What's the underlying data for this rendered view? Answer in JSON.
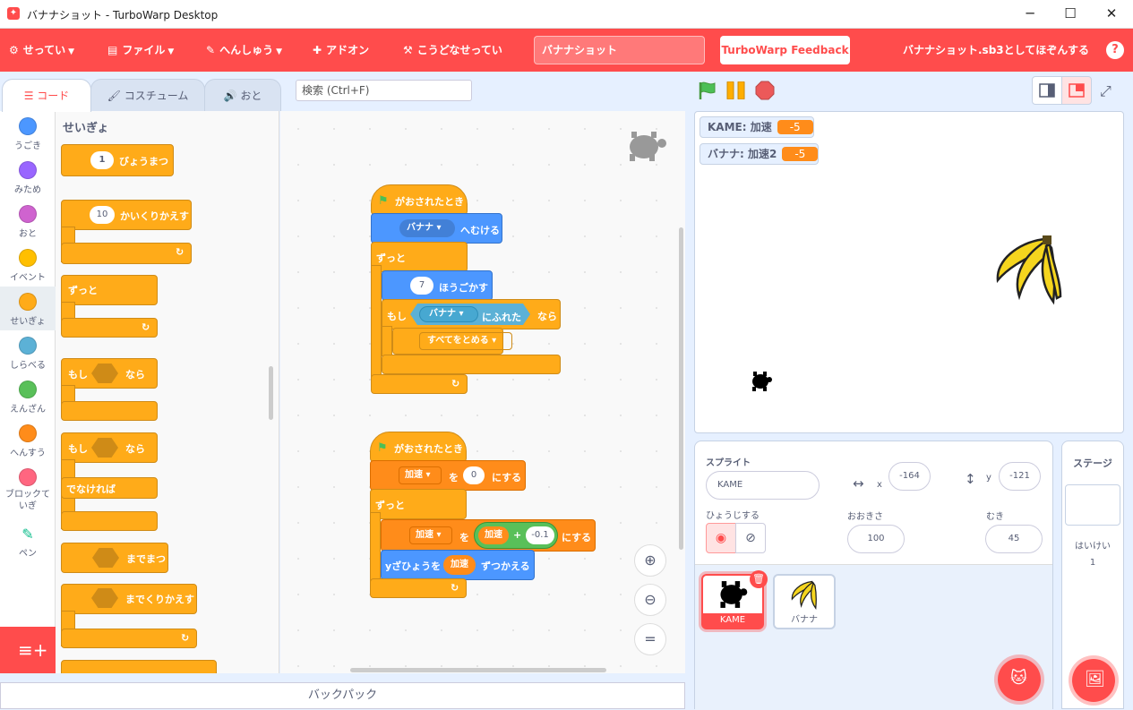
{
  "window": {
    "title": "バナナショット - TurboWarp Desktop",
    "minimize": "─",
    "maximize": "☐",
    "close": "✕"
  },
  "menu": {
    "settings": "せってい",
    "file": "ファイル",
    "edit": "へんしゅう",
    "addons": "アドオン",
    "howto": "こうどなせってい",
    "project_title": "バナナショット",
    "feedback": "TurboWarp Feedback",
    "save_status": "バナナショット.sb3としてほぞんする",
    "help": "?"
  },
  "tabs": {
    "code": "コード",
    "costume": "コスチューム",
    "sound": "おと"
  },
  "search": {
    "placeholder": "検索 (Ctrl+F)"
  },
  "categories": [
    {
      "label": "うごき",
      "color": "#4c97ff"
    },
    {
      "label": "みため",
      "color": "#9966ff"
    },
    {
      "label": "おと",
      "color": "#cf63cf"
    },
    {
      "label": "イベント",
      "color": "#ffbf00"
    },
    {
      "label": "せいぎょ",
      "color": "#ffab19"
    },
    {
      "label": "しらべる",
      "color": "#5cb1d6"
    },
    {
      "label": "えんざん",
      "color": "#59c059"
    },
    {
      "label": "へんすう",
      "color": "#ff8c1a"
    },
    {
      "label": "ブロックていぎ",
      "color": "#ff6680"
    },
    {
      "label": "ペン",
      "color": "#0fbd8c"
    }
  ],
  "palette": {
    "title": "せいぎょ",
    "wait_num": "1",
    "wait_label": "びょうまつ",
    "repeat_num": "10",
    "repeat_label": "かいくりかえす",
    "forever": "ずっと",
    "if": "もし",
    "then": "なら",
    "else": "でなければ",
    "wait_until": "までまつ",
    "repeat_until": "までくりかえす",
    "arrow": "↻"
  },
  "script1": {
    "hat": "がおされたとき",
    "point_target": "バナナ",
    "point_label": "へむける",
    "forever": "ずっと",
    "move_num": "7",
    "move_label": "ほうごかす",
    "if": "もし",
    "touch_target": "バナナ",
    "touch_label": "にふれた",
    "then": "なら",
    "stop": "すべてをとめる"
  },
  "script2": {
    "hat": "がおされたとき",
    "set_var": "加速",
    "set_to": "を",
    "set_val": "0",
    "set_label": "にする",
    "forever": "ずっと",
    "set2_var": "加速",
    "set2_to": "を",
    "op_var": "加速",
    "op_plus": "+",
    "op_val": "-0.1",
    "set2_label": "にする",
    "change_label": "yざひょうを",
    "change_var": "加速",
    "change_suffix": "ずつかえる"
  },
  "monitors": [
    {
      "label": "KAME: 加速",
      "value": "-5"
    },
    {
      "label": "バナナ: 加速2",
      "value": "-5"
    }
  ],
  "sprite_info": {
    "sprite_label": "スプライト",
    "sprite_name": "KAME",
    "x_label": "x",
    "x": "-164",
    "y_label": "y",
    "y": "-121",
    "show_label": "ひょうじする",
    "size_label": "おおきさ",
    "size": "100",
    "direction_label": "むき",
    "direction": "45"
  },
  "sprites": [
    {
      "name": "KAME",
      "selected": true
    },
    {
      "name": "バナナ",
      "selected": false
    }
  ],
  "stage_pane": {
    "title": "ステージ",
    "backdrop_label": "はいけい",
    "backdrop_count": "1"
  },
  "backpack": "バックパック",
  "colors": {
    "accent": "#ff4c4c",
    "control": "#ffab19",
    "motion": "#4c97ff",
    "variables": "#ff8c1a",
    "sensing": "#5cb1d6",
    "events": "#ffbf00",
    "operators": "#59c059"
  }
}
